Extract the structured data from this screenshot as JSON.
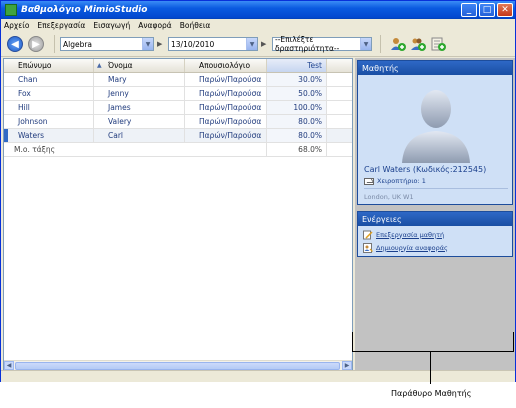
{
  "window": {
    "title": "Βαθμολόγιο MimioStudio",
    "controls": {
      "minimize": "_",
      "maximize": "□",
      "close": "✕"
    }
  },
  "menu": [
    "Αρχείο",
    "Επεξεργασία",
    "Εισαγωγή",
    "Αναφορά",
    "Βοήθεια"
  ],
  "toolbar": {
    "subject": "Algebra",
    "date": "13/10/2010",
    "activity_placeholder": "--Επιλέξτε δραστηριότητα--"
  },
  "grid": {
    "columns": [
      "Επώνυμο",
      "Όνομα",
      "Απουσιολόγιο",
      "Test"
    ],
    "rows": [
      [
        "Chan",
        "Mary",
        "Παρών/Παρούσα",
        "30.0%"
      ],
      [
        "Fox",
        "Jenny",
        "Παρών/Παρούσα",
        "50.0%"
      ],
      [
        "Hill",
        "James",
        "Παρών/Παρούσα",
        "100.0%"
      ],
      [
        "Johnson",
        "Valery",
        "Παρών/Παρούσα",
        "80.0%"
      ],
      [
        "Waters",
        "Carl",
        "Παρών/Παρούσα",
        "80.0%"
      ]
    ],
    "average_label": "Μ.ο. τάξης",
    "average_value": "68.0%"
  },
  "student_panel": {
    "title": "Μαθητής",
    "name": "Carl  Waters (Κωδικός:212545)",
    "clipboard": "Χειροπτήριο: 1",
    "location": "London, UK  W1"
  },
  "actions_panel": {
    "title": "Ενέργειες",
    "items": [
      "Επεξεργασία μαθητή",
      "Δημιουργία αναφοράς"
    ]
  },
  "caption": "Παράθυρο Μαθητής",
  "colors": {
    "title_bar": "#0a5ae0",
    "panel_head": "#2e68c6",
    "panel_bg": "#cfe0f6",
    "accent": "#316ac5"
  }
}
